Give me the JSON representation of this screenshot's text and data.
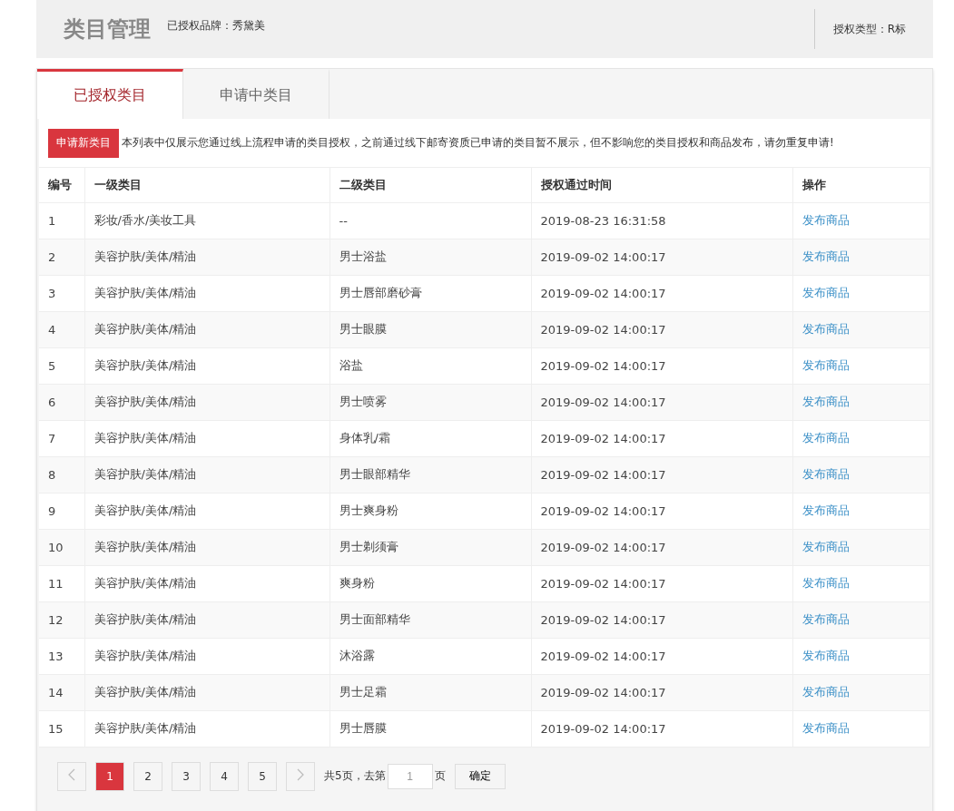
{
  "header": {
    "title": "类目管理",
    "brand": "已授权品牌：秀黛美",
    "auth_type": "授权类型：R标"
  },
  "tabs": [
    {
      "label": "已授权类目",
      "selected": true
    },
    {
      "label": "申请中类目",
      "selected": false
    }
  ],
  "notice": {
    "button": "申请新类目",
    "text": "本列表中仅展示您通过线上流程申请的类目授权，之前通过线下邮寄资质已申请的类目暂不展示，但不影响您的类目授权和商品发布，请勿重复申请!"
  },
  "table": {
    "columns": [
      "编号",
      "一级类目",
      "二级类目",
      "授权通过时间",
      "操作"
    ],
    "rows": [
      [
        "1",
        "彩妆/香水/美妆工具",
        "--",
        "2019-08-23 16:31:58",
        "发布商品"
      ],
      [
        "2",
        "美容护肤/美体/精油",
        "男士浴盐",
        "2019-09-02 14:00:17",
        "发布商品"
      ],
      [
        "3",
        "美容护肤/美体/精油",
        "男士唇部磨砂膏",
        "2019-09-02 14:00:17",
        "发布商品"
      ],
      [
        "4",
        "美容护肤/美体/精油",
        "男士眼膜",
        "2019-09-02 14:00:17",
        "发布商品"
      ],
      [
        "5",
        "美容护肤/美体/精油",
        "浴盐",
        "2019-09-02 14:00:17",
        "发布商品"
      ],
      [
        "6",
        "美容护肤/美体/精油",
        "男士喷雾",
        "2019-09-02 14:00:17",
        "发布商品"
      ],
      [
        "7",
        "美容护肤/美体/精油",
        "身体乳/霜",
        "2019-09-02 14:00:17",
        "发布商品"
      ],
      [
        "8",
        "美容护肤/美体/精油",
        "男士眼部精华",
        "2019-09-02 14:00:17",
        "发布商品"
      ],
      [
        "9",
        "美容护肤/美体/精油",
        "男士爽身粉",
        "2019-09-02 14:00:17",
        "发布商品"
      ],
      [
        "10",
        "美容护肤/美体/精油",
        "男士剃须膏",
        "2019-09-02 14:00:17",
        "发布商品"
      ],
      [
        "11",
        "美容护肤/美体/精油",
        "爽身粉",
        "2019-09-02 14:00:17",
        "发布商品"
      ],
      [
        "12",
        "美容护肤/美体/精油",
        "男士面部精华",
        "2019-09-02 14:00:17",
        "发布商品"
      ],
      [
        "13",
        "美容护肤/美体/精油",
        "沐浴露",
        "2019-09-02 14:00:17",
        "发布商品"
      ],
      [
        "14",
        "美容护肤/美体/精油",
        "男士足霜",
        "2019-09-02 14:00:17",
        "发布商品"
      ],
      [
        "15",
        "美容护肤/美体/精油",
        "男士唇膜",
        "2019-09-02 14:00:17",
        "发布商品"
      ]
    ]
  },
  "pagination": {
    "pages": [
      {
        "label": "1",
        "selected": true
      },
      {
        "label": "2",
        "selected": false
      },
      {
        "label": "3",
        "selected": false
      },
      {
        "label": "4",
        "selected": false
      },
      {
        "label": "5",
        "selected": false
      }
    ],
    "total": "共5页，去第",
    "page_value": "1",
    "unit": "页",
    "confirm": "确定"
  }
}
